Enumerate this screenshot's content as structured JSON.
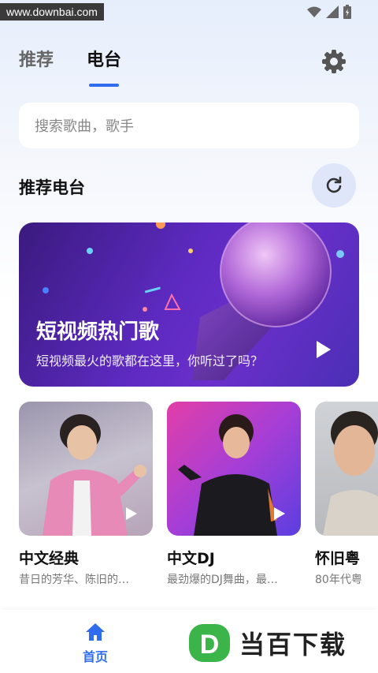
{
  "watermark": "www.downbai.com",
  "tabs": [
    {
      "label": "推荐",
      "active": false
    },
    {
      "label": "电台",
      "active": true
    }
  ],
  "search": {
    "placeholder": "搜索歌曲，歌手"
  },
  "section": {
    "title": "推荐电台"
  },
  "banner": {
    "title": "短视频热门歌",
    "subtitle": "短视频最火的歌都在这里，你听过了吗？"
  },
  "cards": [
    {
      "title": "中文经典",
      "desc": "昔日的芳华、陈旧的…"
    },
    {
      "title": "中文DJ",
      "desc": "最劲爆的DJ舞曲，最…"
    },
    {
      "title": "怀旧粤",
      "desc": "80年代粤"
    }
  ],
  "bottom_nav": {
    "home_label": "首页"
  },
  "brand": {
    "text": "当百下载",
    "logo_letter": "D"
  },
  "colors": {
    "accent": "#2f6cf0",
    "refresh_bg": "#dfe6f9",
    "brand_green": "#3bb54a"
  }
}
